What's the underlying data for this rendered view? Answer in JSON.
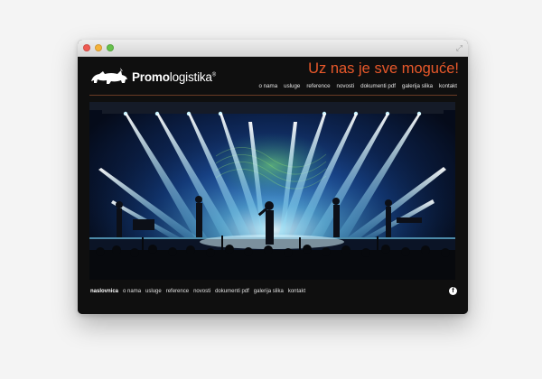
{
  "window": {
    "controls": [
      "close",
      "minimize",
      "zoom"
    ],
    "fullscreen_glyph": "⤢"
  },
  "site": {
    "logo": {
      "bold": "Promo",
      "light": "logistika",
      "registered": "®",
      "icon": "rhino-icon"
    },
    "tagline": "Uz nas je sve moguće!",
    "top_nav": [
      "o nama",
      "usluge",
      "reference",
      "novosti",
      "dokumenti pdf",
      "galerija slika",
      "kontakt"
    ],
    "bottom_nav": [
      "naslovnica",
      "o nama",
      "usluge",
      "reference",
      "novosti",
      "dokumenti pdf",
      "galerija slika",
      "kontakt"
    ],
    "bottom_nav_active": "naslovnica",
    "social": {
      "facebook_glyph": "f",
      "icon": "facebook-icon"
    }
  },
  "colors": {
    "accent": "#e8582a",
    "background": "#0f0f0f",
    "hero_light": "#8fe9ff"
  }
}
